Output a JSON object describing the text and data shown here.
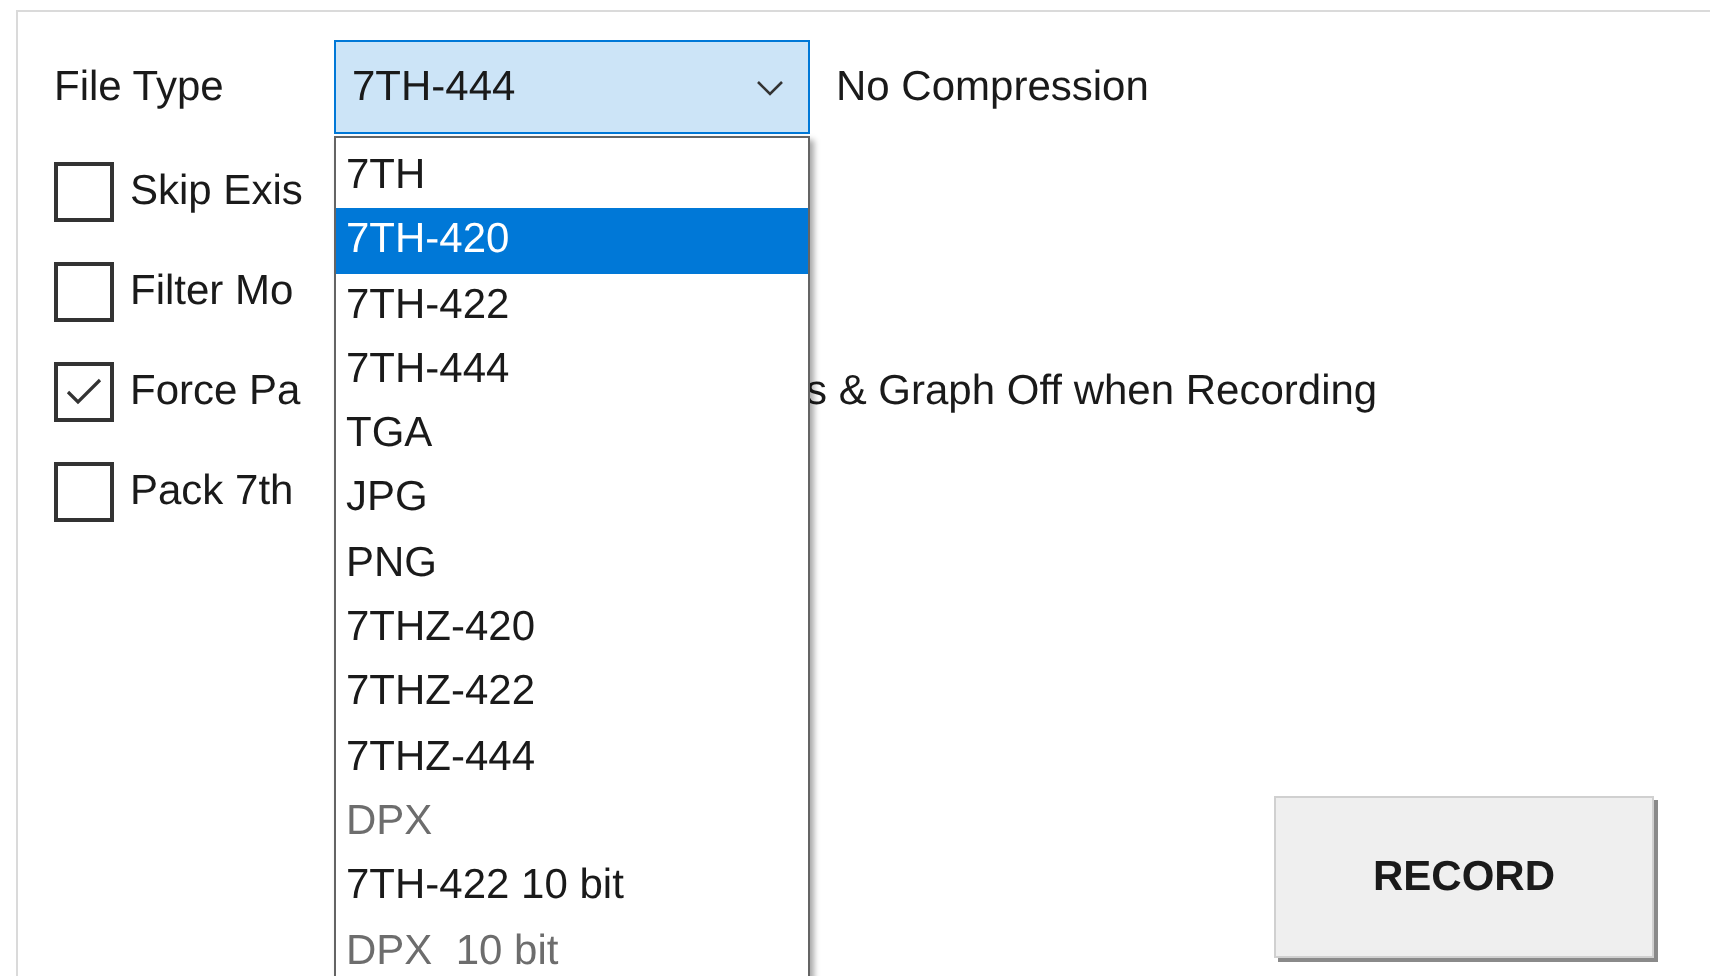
{
  "file_type": {
    "label": "File Type",
    "value": "7TH-444",
    "note": "No Compression",
    "options": [
      {
        "label": "7TH",
        "highlighted": false,
        "disabled": false
      },
      {
        "label": "7TH-420",
        "highlighted": true,
        "disabled": false
      },
      {
        "label": "7TH-422",
        "highlighted": false,
        "disabled": false
      },
      {
        "label": "7TH-444",
        "highlighted": false,
        "disabled": false
      },
      {
        "label": "TGA",
        "highlighted": false,
        "disabled": false
      },
      {
        "label": "JPG",
        "highlighted": false,
        "disabled": false
      },
      {
        "label": "PNG",
        "highlighted": false,
        "disabled": false
      },
      {
        "label": "7THZ-420",
        "highlighted": false,
        "disabled": false
      },
      {
        "label": "7THZ-422",
        "highlighted": false,
        "disabled": false
      },
      {
        "label": "7THZ-444",
        "highlighted": false,
        "disabled": false
      },
      {
        "label": "DPX",
        "highlighted": false,
        "disabled": true
      },
      {
        "label": "7TH-422 10 bit",
        "highlighted": false,
        "disabled": false
      },
      {
        "label": "DPX  10 bit",
        "highlighted": false,
        "disabled": true
      }
    ]
  },
  "options": [
    {
      "label": "Skip Exis",
      "checked": false
    },
    {
      "label": "Filter Mo",
      "checked": false
    },
    {
      "label": "Force Pa",
      "label_tail": "s & Graph Off when Recording",
      "checked": true
    },
    {
      "label": "Pack 7th",
      "checked": false
    }
  ],
  "record_button": "RECORD"
}
